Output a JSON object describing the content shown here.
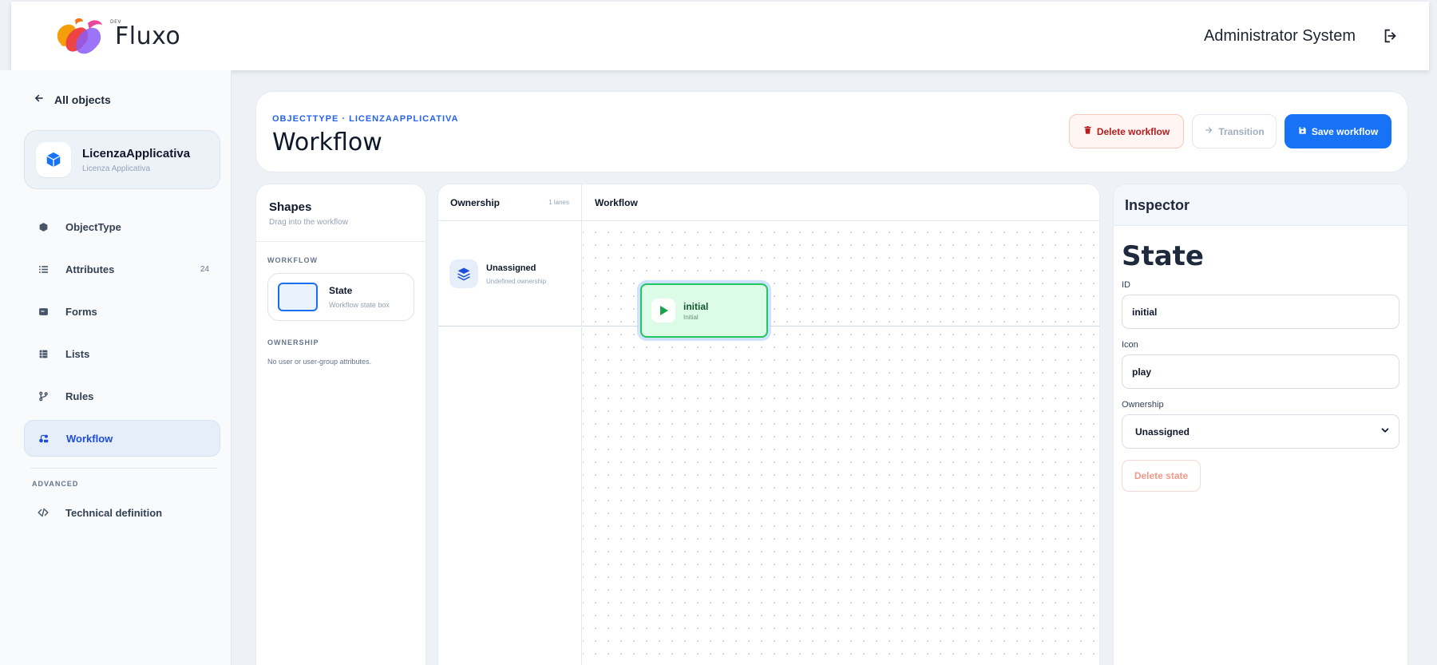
{
  "app": {
    "logo_text": "Fluxo",
    "logo_small": "DEV",
    "user_name": "Administrator System"
  },
  "sidebar": {
    "back_label": "All objects",
    "object": {
      "title": "LicenzaApplicativa",
      "subtitle": "Licenza Applicativa"
    },
    "items": [
      {
        "label": "ObjectType",
        "icon": "cube-icon"
      },
      {
        "label": "Attributes",
        "icon": "list-icon",
        "count": "24"
      },
      {
        "label": "Forms",
        "icon": "form-icon"
      },
      {
        "label": "Lists",
        "icon": "table-icon"
      },
      {
        "label": "Rules",
        "icon": "branch-icon"
      },
      {
        "label": "Workflow",
        "icon": "workflow-icon",
        "active": true
      }
    ],
    "advanced_label": "ADVANCED",
    "advanced_items": [
      {
        "label": "Technical definition",
        "icon": "code-icon"
      }
    ]
  },
  "header": {
    "breadcrumb": "OBJECTTYPE · LICENZAAPPLICATIVA",
    "title": "Workflow",
    "delete_label": "Delete workflow",
    "transition_label": "Transition",
    "save_label": "Save workflow"
  },
  "shapes": {
    "title": "Shapes",
    "subtitle": "Drag into the workflow",
    "workflow_group": "WORKFLOW",
    "state_tile": {
      "title": "State",
      "subtitle": "Workflow state box"
    },
    "ownership_group": "OWNERSHIP",
    "ownership_empty": "No user or user-group attributes."
  },
  "canvas": {
    "ownership_header": "Ownership",
    "lanes_count": "1 lanes",
    "workflow_header": "Workflow",
    "lane": {
      "title": "Unassigned",
      "subtitle": "Undefined ownership"
    },
    "node": {
      "title": "initial",
      "subtitle": "Initial",
      "icon": "play-icon"
    }
  },
  "inspector": {
    "title": "Inspector",
    "heading": "State",
    "id_label": "ID",
    "id_value": "initial",
    "icon_label": "Icon",
    "icon_value": "play",
    "ownership_label": "Ownership",
    "ownership_value": "Unassigned",
    "delete_state_label": "Delete state"
  },
  "colors": {
    "accent": "#1772f5",
    "danger": "#b91c1c",
    "node_fill": "#dcfce7",
    "node_border": "#22c55e"
  }
}
